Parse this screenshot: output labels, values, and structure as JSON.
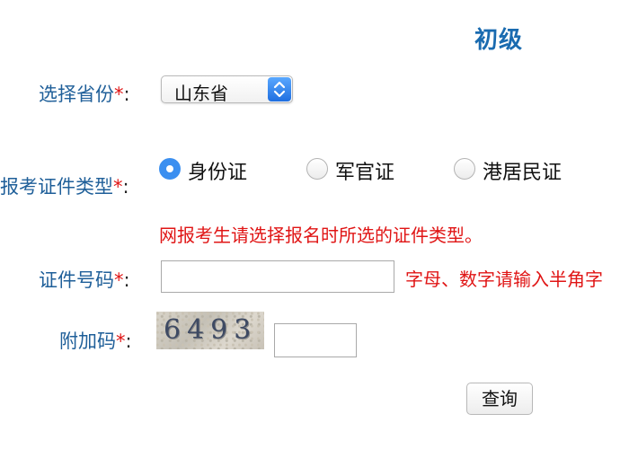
{
  "page": {
    "title": "初级"
  },
  "form": {
    "province": {
      "label": "选择省份",
      "required_mark": "*",
      "colon": ":",
      "selected": "山东省"
    },
    "id_type": {
      "label": "报考证件类型",
      "required_mark": "*",
      "colon": ":",
      "options": [
        {
          "label": "身份证",
          "checked": true
        },
        {
          "label": "军官证",
          "checked": false
        },
        {
          "label": "港居民证",
          "checked": false
        }
      ],
      "notice": "网报考生请选择报名时所选的证件类型。"
    },
    "id_number": {
      "label": "证件号码",
      "required_mark": "*",
      "colon": ":",
      "value": "",
      "hint": "字母、数字请输入半角字"
    },
    "captcha": {
      "label": "附加码",
      "required_mark": "*",
      "colon": ":",
      "image_text": "6493",
      "value": ""
    },
    "submit_label": "查询"
  },
  "colors": {
    "label": "#1f5f99",
    "title": "#1a6bb0",
    "required": "#e01515",
    "warning": "#e01515",
    "radio_selected": "#3b8ff0",
    "select_arrow": "#1f6fe0"
  },
  "icons": {
    "select_arrow": "up-down-chevron-icon"
  }
}
